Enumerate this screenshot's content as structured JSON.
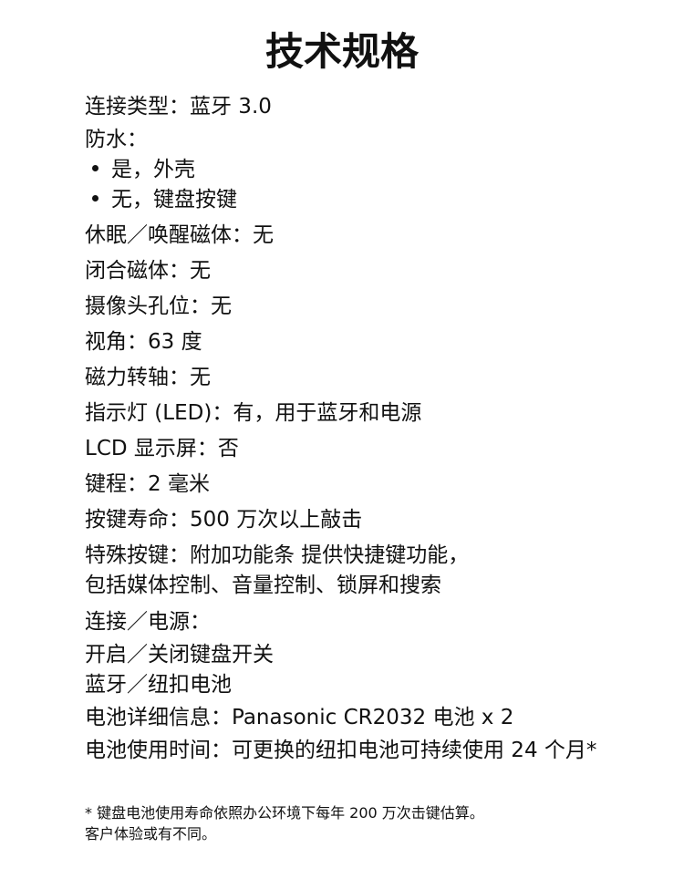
{
  "title": "技术规格",
  "specs": [
    "连接类型：蓝牙 3.0",
    "防水："
  ],
  "waterproof_bullets": [
    "是，外壳",
    "无，键盘按键"
  ],
  "specs2": [
    "休眠／唤醒磁体：无",
    "闭合磁体：无",
    "摄像头孔位：无",
    "视角：63 度",
    "磁力转轴：无",
    "指示灯 (LED)：有，用于蓝牙和电源",
    "LCD 显示屏：否",
    "键程：2 毫米",
    "按键寿命：500 万次以上敲击"
  ],
  "special_keys": [
    "特殊按键：附加功能条 提供快捷键功能，",
    "包括媒体控制、音量控制、锁屏和搜索"
  ],
  "power": [
    "连接／电源：",
    "开启／关闭键盘开关",
    "蓝牙／纽扣电池"
  ],
  "battery": [
    "电池详细信息：Panasonic CR2032 电池 x 2",
    "电池使用时间：可更换的纽扣电池可持续使用 24 个月*"
  ],
  "footnote": [
    "* 键盘电池使用寿命依照办公环境下每年 200 万次击键估算。",
    "客户体验或有不同。"
  ]
}
